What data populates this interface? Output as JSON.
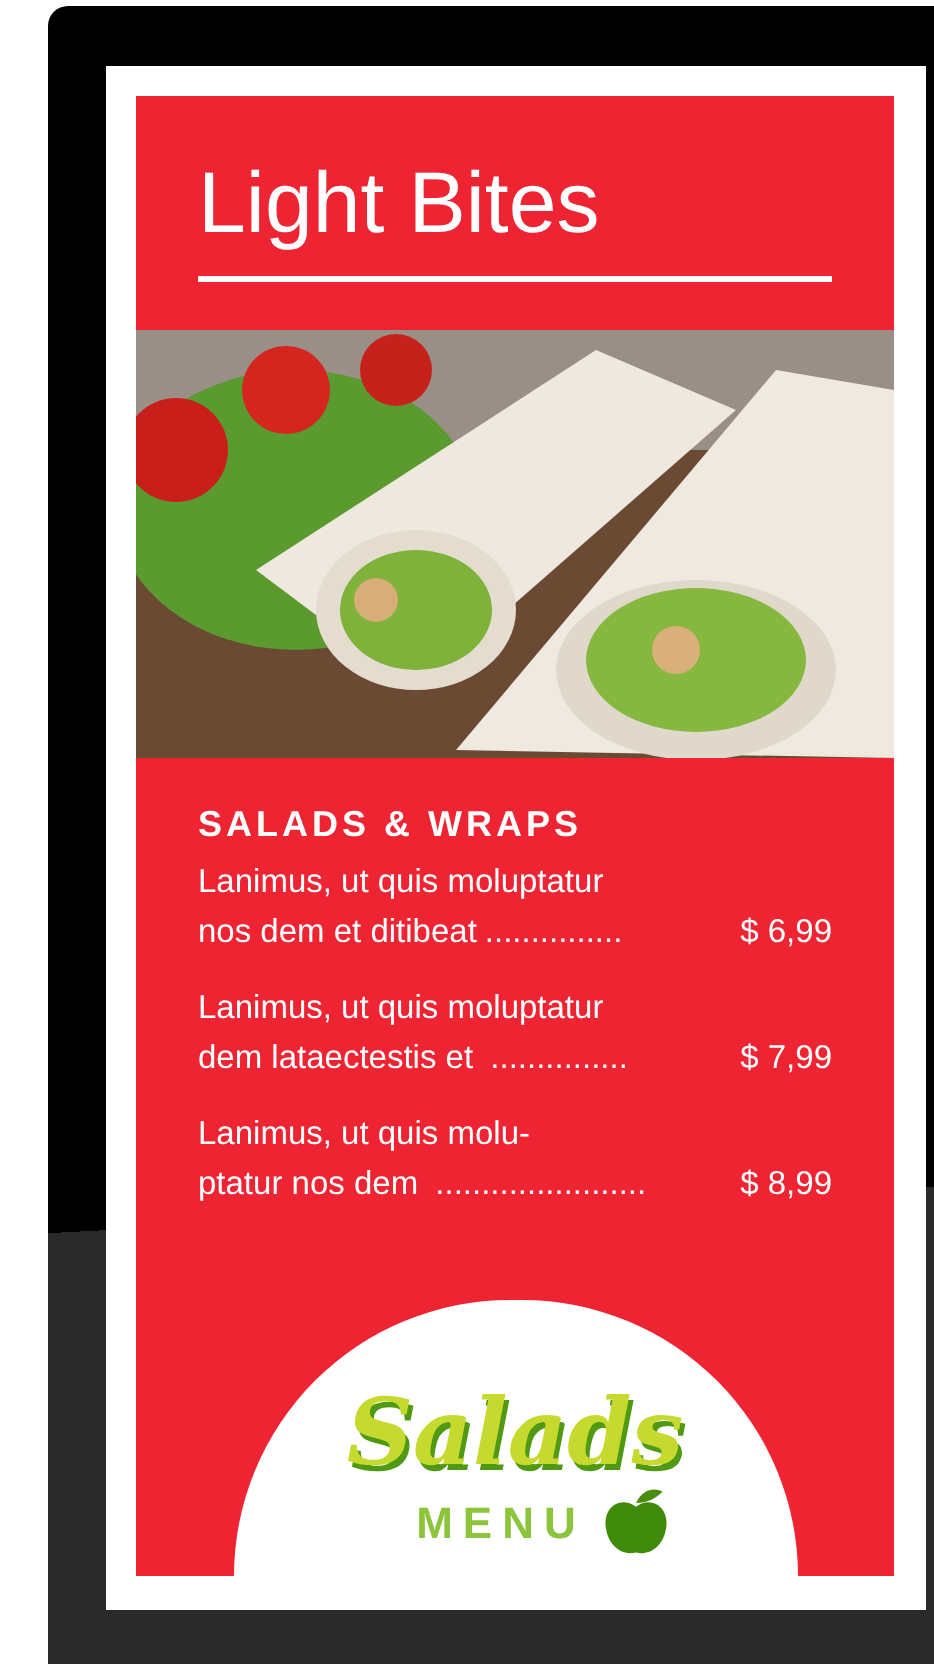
{
  "title": "Light Bites",
  "section": {
    "heading": "SALADS & WRAPS",
    "items": [
      {
        "line1": "Lanimus, ut quis moluptatur",
        "line2": "nos dem et ditibeat",
        "leader": "...............",
        "price": "$ 6,99"
      },
      {
        "line1": "Lanimus, ut quis moluptatur",
        "line2": "dem lataectestis et ",
        "leader": "...............",
        "price": "$ 7,99"
      },
      {
        "line1": "Lanimus, ut quis molu-",
        "line2": "ptatur nos dem ",
        "leader": ".......................",
        "price": "$ 8,99"
      }
    ]
  },
  "logo": {
    "word": "Salads",
    "sub": "MENU"
  }
}
